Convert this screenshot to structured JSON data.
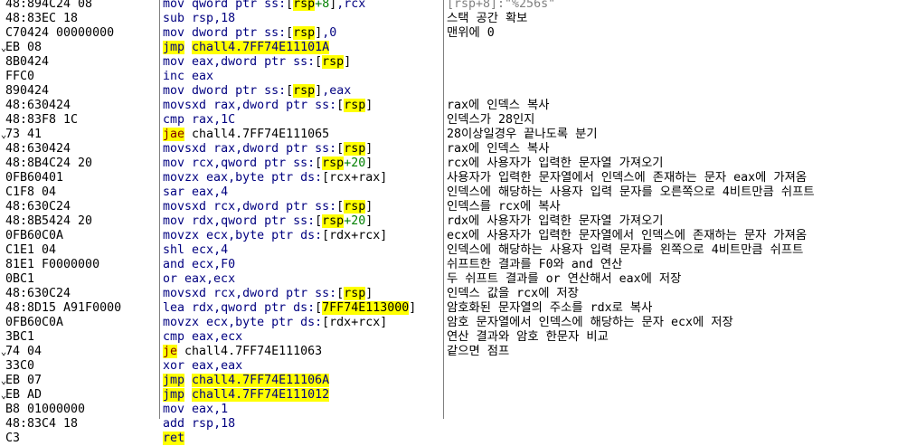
{
  "window": {
    "colors": {
      "background": "#ffffff",
      "mnemonic": "#000080",
      "highlight": "#ffff00",
      "separator": "#808080",
      "conditional_jump": "#800000",
      "offset": "#008000"
    }
  },
  "rows": [
    {
      "arrow": "",
      "bytes": "48:894C24 08",
      "instr": "mov qword ptr ss:[rsp+8],rcx",
      "comment": "[rsp+8]:\"%256s\""
    },
    {
      "arrow": "",
      "bytes": "48:83EC 18",
      "instr": "sub rsp,18",
      "comment": "스택 공간 확보"
    },
    {
      "arrow": "",
      "bytes": "C70424 00000000",
      "instr": "mov dword ptr ss:[rsp],0",
      "comment": "맨위에 0"
    },
    {
      "arrow": "⌄",
      "bytes": "EB 08",
      "instr": "jmp chall4.7FF74E11101A",
      "comment": ""
    },
    {
      "arrow": "",
      "bytes": "8B0424",
      "instr": "mov eax,dword ptr ss:[rsp]",
      "comment": ""
    },
    {
      "arrow": "",
      "bytes": "FFC0",
      "instr": "inc eax",
      "comment": ""
    },
    {
      "arrow": "",
      "bytes": "890424",
      "instr": "mov dword ptr ss:[rsp],eax",
      "comment": ""
    },
    {
      "arrow": "",
      "bytes": "48:630424",
      "instr": "movsxd rax,dword ptr ss:[rsp]",
      "comment": "rax에 인덱스 복사"
    },
    {
      "arrow": "",
      "bytes": "48:83F8 1C",
      "instr": "cmp rax,1C",
      "comment": "인덱스가 28인지"
    },
    {
      "arrow": "⌄",
      "bytes": "73 41",
      "instr": "jae chall4.7FF74E111065",
      "comment": "28이상일경우 끝나도록 분기"
    },
    {
      "arrow": "",
      "bytes": "48:630424",
      "instr": "movsxd rax,dword ptr ss:[rsp]",
      "comment": "rax에 인덱스 복사"
    },
    {
      "arrow": "",
      "bytes": "48:8B4C24 20",
      "instr": "mov rcx,qword ptr ss:[rsp+20]",
      "comment": "rcx에 사용자가 입력한 문자열 가져오기"
    },
    {
      "arrow": "",
      "bytes": "0FB60401",
      "instr": "movzx eax,byte ptr ds:[rcx+rax]",
      "comment": "사용자가 입력한 문자열에서 인덱스에 존재하는 문자 eax에 가져옴"
    },
    {
      "arrow": "",
      "bytes": "C1F8 04",
      "instr": "sar eax,4",
      "comment": "인덱스에 해당하는 사용자 입력 문자를 오른쪽으로 4비트만큼 쉬프트"
    },
    {
      "arrow": "",
      "bytes": "48:630C24",
      "instr": "movsxd rcx,dword ptr ss:[rsp]",
      "comment": "인덱스를 rcx에 복사"
    },
    {
      "arrow": "",
      "bytes": "48:8B5424 20",
      "instr": "mov rdx,qword ptr ss:[rsp+20]",
      "comment": "rdx에 사용자가 입력한 문자열 가져오기"
    },
    {
      "arrow": "",
      "bytes": "0FB60C0A",
      "instr": "movzx ecx,byte ptr ds:[rdx+rcx]",
      "comment": "ecx에 사용자가 입력한 문자열에서 인덱스에 존재하는 문자 가져옴"
    },
    {
      "arrow": "",
      "bytes": "C1E1 04",
      "instr": "shl ecx,4",
      "comment": "인덱스에 해당하는 사용자 입력 문자를 왼쪽으로 4비트만큼 쉬프트"
    },
    {
      "arrow": "",
      "bytes": "81E1 F0000000",
      "instr": "and ecx,F0",
      "comment": "쉬프트한 결과를 F0와 and 연산"
    },
    {
      "arrow": "",
      "bytes": "0BC1",
      "instr": "or eax,ecx",
      "comment": "두 쉬프트 결과를 or 연산해서 eax에 저장"
    },
    {
      "arrow": "",
      "bytes": "48:630C24",
      "instr": "movsxd rcx,dword ptr ss:[rsp]",
      "comment": "인덱스 값을 rcx에 저장"
    },
    {
      "arrow": "",
      "bytes": "48:8D15 A91F0000",
      "instr": "lea rdx,qword ptr ds:[7FF74E113000]",
      "comment": "암호화된 문자열의 주소를 rdx로 복사"
    },
    {
      "arrow": "",
      "bytes": "0FB60C0A",
      "instr": "movzx ecx,byte ptr ds:[rdx+rcx]",
      "comment": "암호 문자열에서 인덱스에 해당하는 문자 ecx에 저장"
    },
    {
      "arrow": "",
      "bytes": "3BC1",
      "instr": "cmp eax,ecx",
      "comment": "연산 결과와 암호 한문자 비교"
    },
    {
      "arrow": "⌄",
      "bytes": "74 04",
      "instr": "je chall4.7FF74E111063",
      "comment": "같으면 점프"
    },
    {
      "arrow": "",
      "bytes": "33C0",
      "instr": "xor eax,eax",
      "comment": ""
    },
    {
      "arrow": "⌄",
      "bytes": "EB 07",
      "instr": "jmp chall4.7FF74E11106A",
      "comment": ""
    },
    {
      "arrow": "⌄",
      "bytes": "EB AD",
      "instr": "jmp chall4.7FF74E111012",
      "comment": ""
    },
    {
      "arrow": "",
      "bytes": "B8 01000000",
      "instr": "mov eax,1",
      "comment": ""
    },
    {
      "arrow": "",
      "bytes": "48:83C4 18",
      "instr": "add rsp,18",
      "comment": ""
    },
    {
      "arrow": "",
      "bytes": "C3",
      "instr": "ret",
      "comment": ""
    }
  ]
}
